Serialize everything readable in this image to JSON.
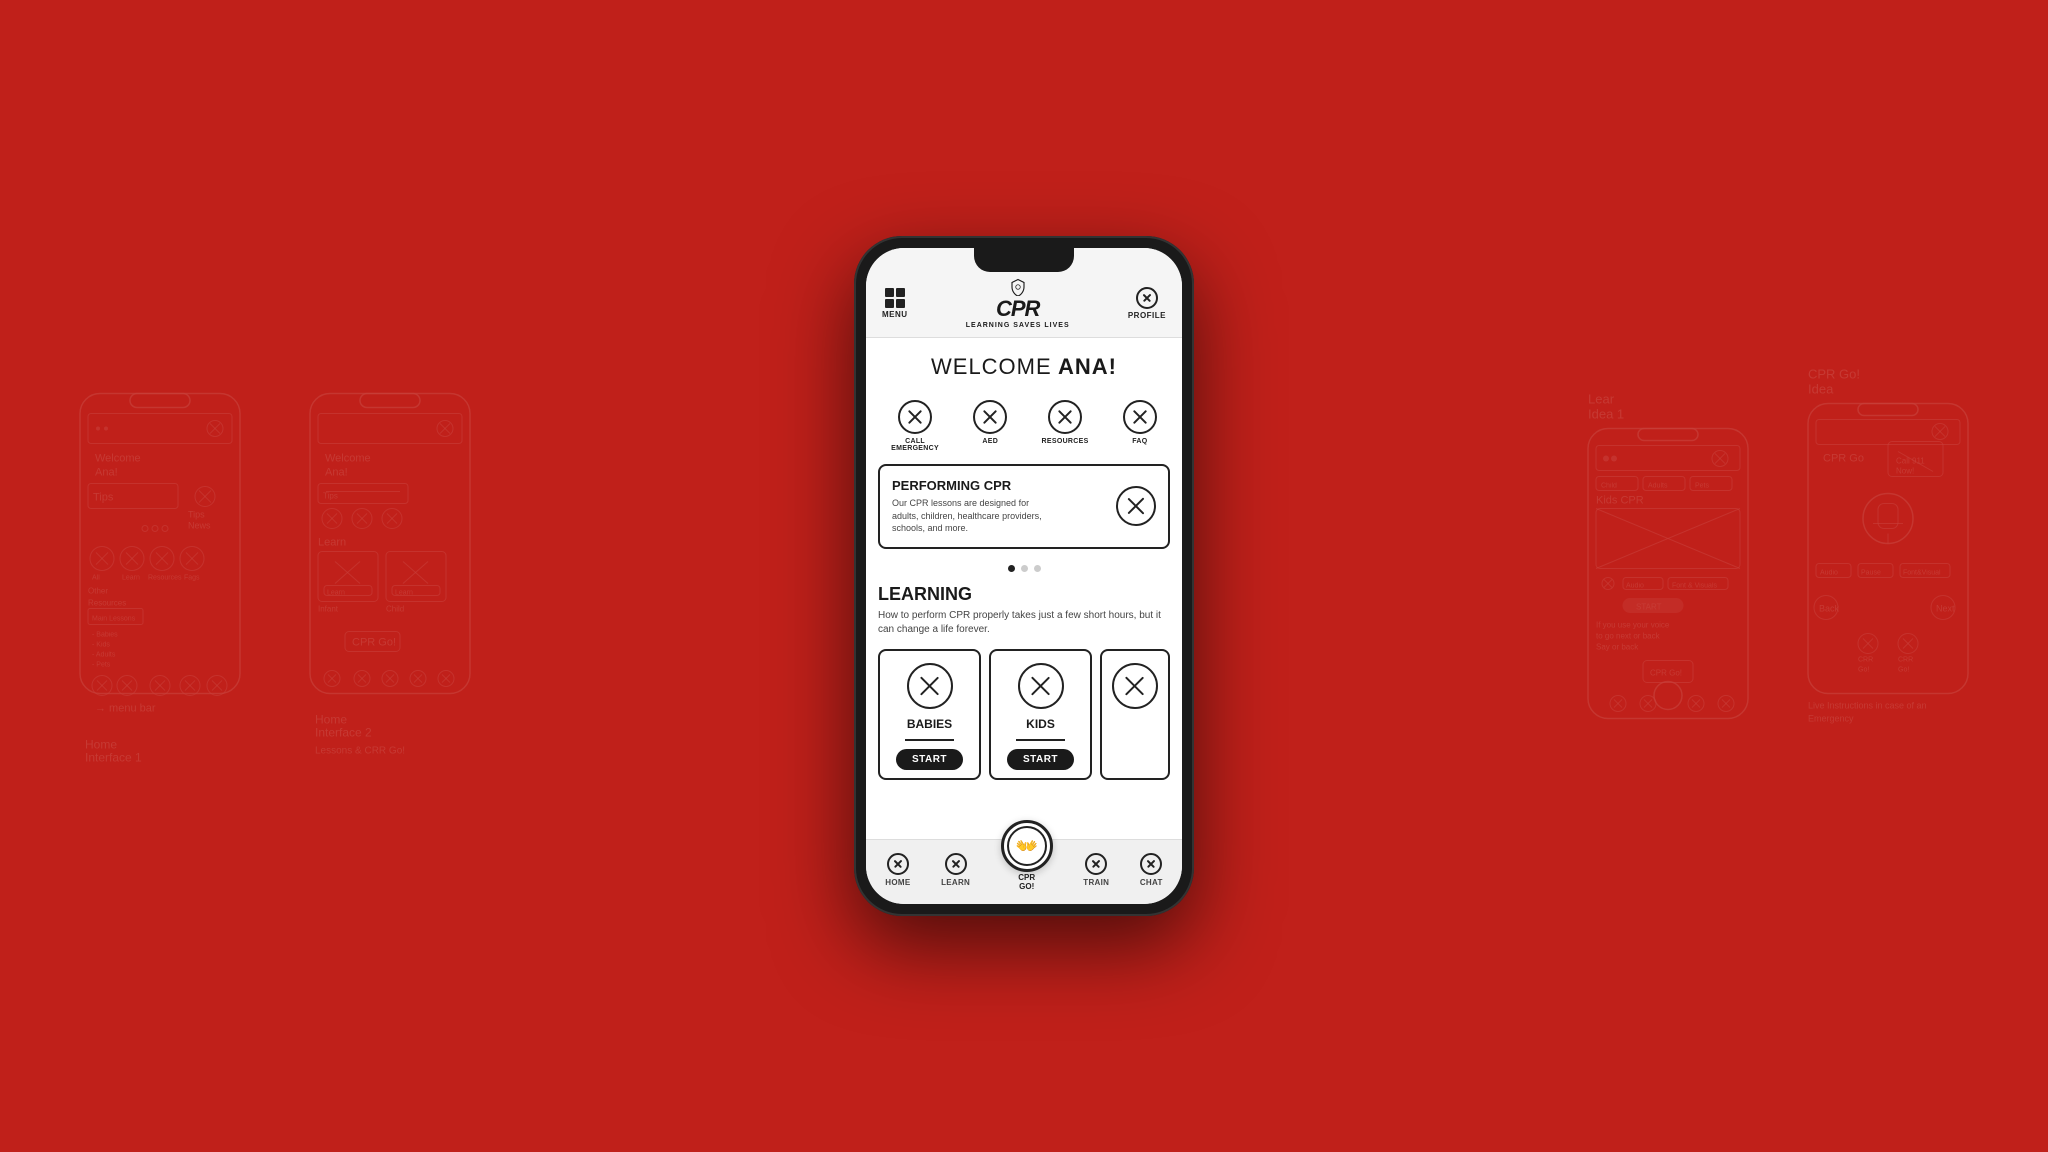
{
  "background_color": "#c0201a",
  "app": {
    "title": "CPR",
    "subtitle": "LEARNING SAVES LIVES",
    "menu_label": "MENU",
    "profile_label": "PROFILE"
  },
  "welcome": {
    "text": "WELCOME",
    "user": "ANA!"
  },
  "quick_actions": [
    {
      "label": "CALL\nEMERGENCY",
      "id": "call-emergency"
    },
    {
      "label": "AED",
      "id": "aed"
    },
    {
      "label": "RESOURCES",
      "id": "resources"
    },
    {
      "label": "FAQ",
      "id": "faq"
    }
  ],
  "featured_card": {
    "title": "PERFORMING CPR",
    "description": "Our CPR lessons are designed for adults, children, healthcare providers, schools, and more."
  },
  "learning": {
    "title": "LEARNING",
    "subtitle": "How to perform CPR properly takes just a few short hours, but it can change a life forever.",
    "cards": [
      {
        "title": "BABIES",
        "start_label": "START"
      },
      {
        "title": "KIDS",
        "start_label": "START"
      }
    ]
  },
  "bottom_nav": [
    {
      "label": "HOME",
      "id": "home"
    },
    {
      "label": "LEARN",
      "id": "learn"
    },
    {
      "label": "CPR\nGO!",
      "id": "cpr-go",
      "center": true
    },
    {
      "label": "TRAIN",
      "id": "train"
    },
    {
      "label": "CHAT",
      "id": "chat"
    }
  ],
  "sketches": {
    "left1_label": "Home Interface 1",
    "left2_label": "Home Interface 2",
    "right1_label": "LEARN IDEA 1",
    "right2_label": "CPR GO! Idea"
  }
}
